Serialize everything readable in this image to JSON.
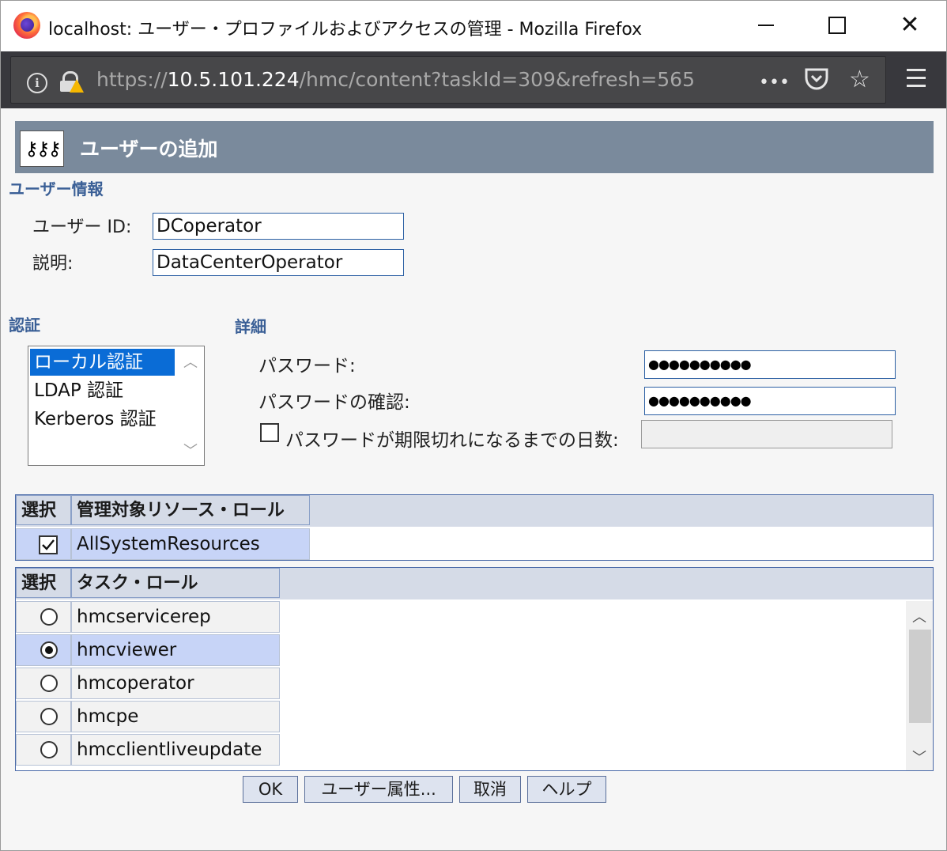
{
  "window": {
    "title": "localhost: ユーザー・プロファイルおよびアクセスの管理 - Mozilla Firefox"
  },
  "browser": {
    "url_scheme": "https://",
    "url_host": "10.5.101.224",
    "url_path": "/hmc/content?taskId=309&refresh=565",
    "more_label": "•••"
  },
  "header": {
    "title": "ユーザーの追加",
    "icon_text": "⚷⚷⚷"
  },
  "user_info": {
    "section_label": "ユーザー情報",
    "user_id_label": "ユーザー ID:",
    "user_id_value": "DCoperator",
    "description_label": "説明:",
    "description_value": "DataCenterOperator"
  },
  "auth": {
    "section_label": "認証",
    "options": [
      "ローカル認証",
      "LDAP 認証",
      "Kerberos 認証"
    ],
    "selected": "ローカル認証"
  },
  "details": {
    "section_label": "詳細",
    "password_label": "パスワード:",
    "password_value": "●●●●●●●●●●",
    "confirm_label": "パスワードの確認:",
    "confirm_value": "●●●●●●●●●●",
    "expiry_label": "パスワードが期限切れになるまでの日数:",
    "expiry_checked": false
  },
  "resource_table": {
    "col_select": "選択",
    "col_name": "管理対象リソース・ロール",
    "rows": [
      {
        "name": "AllSystemResources",
        "checked": true
      }
    ]
  },
  "task_table": {
    "col_select": "選択",
    "col_name": "タスク・ロール",
    "rows": [
      {
        "name": "hmcservicerep",
        "selected": false
      },
      {
        "name": "hmcviewer",
        "selected": true
      },
      {
        "name": "hmcoperator",
        "selected": false
      },
      {
        "name": "hmcpe",
        "selected": false
      },
      {
        "name": "hmcclientliveupdate",
        "selected": false
      }
    ]
  },
  "buttons": {
    "ok": "OK",
    "user_properties": "ユーザー属性...",
    "cancel": "取消",
    "help": "ヘルプ"
  }
}
